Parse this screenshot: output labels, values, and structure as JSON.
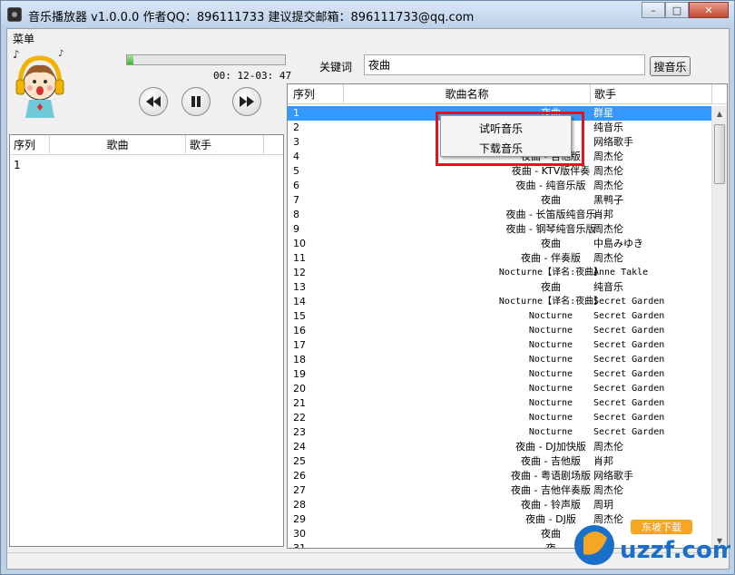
{
  "window": {
    "title": "音乐播放器 v1.0.0.0   作者QQ：896111733 建议提交邮箱：896111733@qq.com",
    "controls": {
      "minimize": "–",
      "maximize": "□",
      "close": "✕"
    }
  },
  "menu": {
    "label": "菜单"
  },
  "player": {
    "progress_fraction": 0.04,
    "time": "00: 12-03: 47",
    "buttons": [
      "rewind-icon",
      "pause-icon",
      "fast-forward-icon"
    ]
  },
  "search": {
    "label": "关键词",
    "value": "夜曲",
    "button": "搜音乐"
  },
  "playlist": {
    "columns": [
      "序列",
      "歌曲",
      "歌手"
    ],
    "rows": [
      {
        "index": "1"
      }
    ]
  },
  "results": {
    "columns": [
      "序列",
      "歌曲名称",
      "歌手"
    ],
    "rows": [
      {
        "index": "1",
        "name": "夜曲",
        "artist": "群星",
        "selected": true
      },
      {
        "index": "2",
        "name": "夜曲",
        "artist": "纯音乐"
      },
      {
        "index": "3",
        "name": "",
        "artist": "网络歌手"
      },
      {
        "index": "4",
        "name": "夜曲 - 吉他版",
        "artist": "周杰伦"
      },
      {
        "index": "5",
        "name": "夜曲 - KTV版伴奏",
        "artist": "周杰伦"
      },
      {
        "index": "6",
        "name": "夜曲 - 纯音乐版",
        "artist": "周杰伦"
      },
      {
        "index": "7",
        "name": "夜曲",
        "artist": "黑鸭子"
      },
      {
        "index": "8",
        "name": "夜曲 - 长笛版纯音乐",
        "artist": "肖邦"
      },
      {
        "index": "9",
        "name": "夜曲 - 钢琴纯音乐版",
        "artist": "周杰伦"
      },
      {
        "index": "10",
        "name": "夜曲",
        "artist": "中島みゆき"
      },
      {
        "index": "11",
        "name": "夜曲 - 伴奏版",
        "artist": "周杰伦"
      },
      {
        "index": "12",
        "name": "Nocturne【译名:夜曲】",
        "artist": "Anne Takle"
      },
      {
        "index": "13",
        "name": "夜曲",
        "artist": "纯音乐"
      },
      {
        "index": "14",
        "name": "Nocturne【译名:夜曲】",
        "artist": "Secret Garden"
      },
      {
        "index": "15",
        "name": "Nocturne",
        "artist": "Secret Garden"
      },
      {
        "index": "16",
        "name": "Nocturne",
        "artist": "Secret Garden"
      },
      {
        "index": "17",
        "name": "Nocturne",
        "artist": "Secret Garden"
      },
      {
        "index": "18",
        "name": "Nocturne",
        "artist": "Secret Garden"
      },
      {
        "index": "19",
        "name": "Nocturne",
        "artist": "Secret Garden"
      },
      {
        "index": "20",
        "name": "Nocturne",
        "artist": "Secret Garden"
      },
      {
        "index": "21",
        "name": "Nocturne",
        "artist": "Secret Garden"
      },
      {
        "index": "22",
        "name": "Nocturne",
        "artist": "Secret Garden"
      },
      {
        "index": "23",
        "name": "Nocturne",
        "artist": "Secret Garden"
      },
      {
        "index": "24",
        "name": "夜曲 - DJ加快版",
        "artist": "周杰伦"
      },
      {
        "index": "25",
        "name": "夜曲 - 吉他版",
        "artist": "肖邦"
      },
      {
        "index": "26",
        "name": "夜曲 - 粤语剧场版",
        "artist": "网络歌手"
      },
      {
        "index": "27",
        "name": "夜曲 - 吉他伴奏版",
        "artist": "周杰伦"
      },
      {
        "index": "28",
        "name": "夜曲 - 铃声版",
        "artist": "周玥"
      },
      {
        "index": "29",
        "name": "夜曲 - DJ版",
        "artist": "周杰伦"
      },
      {
        "index": "30",
        "name": "夜曲",
        "artist": ""
      },
      {
        "index": "31",
        "name": "夜",
        "artist": ""
      }
    ]
  },
  "context_menu": {
    "items": [
      "试听音乐",
      "下载音乐"
    ],
    "highlight_color": "#e3121b"
  },
  "watermark": {
    "text": "uzzf.com",
    "badge": "东坡下载"
  },
  "colors": {
    "selection": "#3399ff",
    "progress": "#3fb03a",
    "titlebar": "#bcd1ea"
  }
}
